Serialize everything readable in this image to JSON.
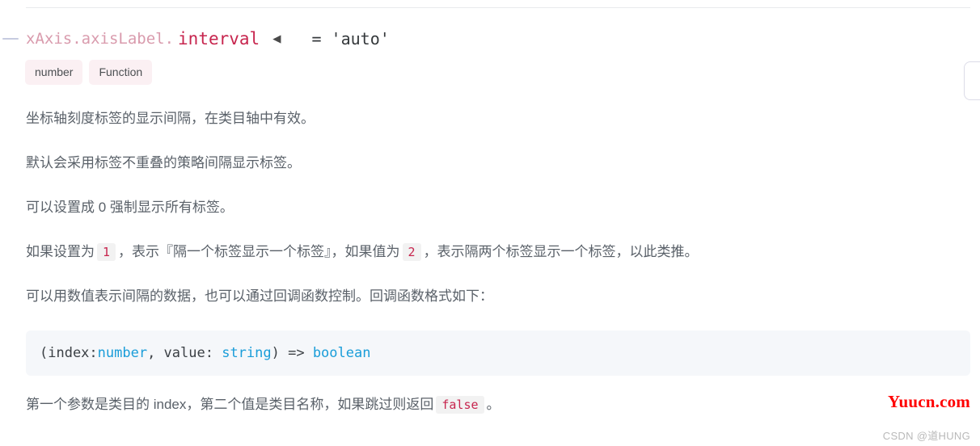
{
  "heading": {
    "path": "xAxis.axisLabel.",
    "name": "interval",
    "collapse_arrow": "◀",
    "equals": "=",
    "default_value": "'auto'",
    "path_color": "#d99bad",
    "name_color": "#c7254e"
  },
  "type_tags": [
    {
      "label": "number"
    },
    {
      "label": "Function"
    }
  ],
  "paragraphs": {
    "p1": "坐标轴刻度标签的显示间隔，在类目轴中有效。",
    "p2": "默认会采用标签不重叠的策略间隔显示标签。",
    "p3": "可以设置成 0 强制显示所有标签。",
    "p4_a": "如果设置为",
    "p4_code1": "1",
    "p4_b": "，表示『隔一个标签显示一个标签』，如果值为",
    "p4_code2": "2",
    "p4_c": "，表示隔两个标签显示一个标签，以此类推。",
    "p5": "可以用数值表示间隔的数据，也可以通过回调函数控制。回调函数格式如下：",
    "p6_a": "第一个参数是类目的 index，第二个值是类目名称，如果跳过则返回",
    "p6_code": "false",
    "p6_b": "。"
  },
  "code_block": {
    "seg1": "(index:",
    "seg2": "number",
    "seg3": ", value: ",
    "seg4": "string",
    "seg5": ") => ",
    "seg6": "boolean",
    "type_color": "#1a9dd9",
    "background": "#f5f7fa"
  },
  "watermarks": {
    "site": "Yuucn.com",
    "site_color": "#ff0000",
    "csdn": "CSDN @道HUNG"
  }
}
